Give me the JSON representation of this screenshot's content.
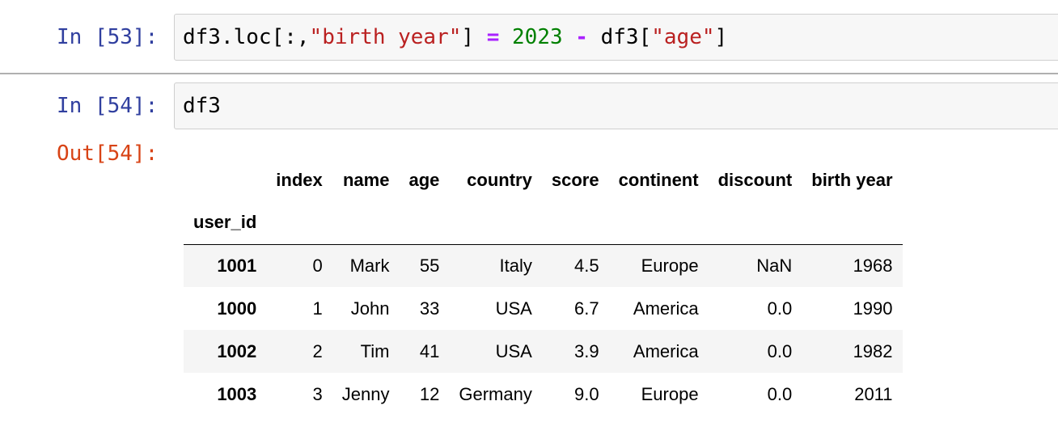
{
  "cells": [
    {
      "prompt": "In [53]:",
      "code": {
        "t1": "df3.loc[:,",
        "t2": "\"birth year\"",
        "t3": "] ",
        "t4": "=",
        "t5": " ",
        "t6": "2023",
        "t7": " ",
        "t8": "-",
        "t9": " df3[",
        "t10": "\"age\"",
        "t11": "]"
      }
    },
    {
      "prompt": "In [54]:",
      "code": "df3",
      "out_prompt": "Out[54]:"
    }
  ],
  "dataframe": {
    "columns": [
      "index",
      "name",
      "age",
      "country",
      "score",
      "continent",
      "discount",
      "birth year"
    ],
    "index_name": "user_id",
    "rows": [
      {
        "id": "1001",
        "values": [
          "0",
          "Mark",
          "55",
          "Italy",
          "4.5",
          "Europe",
          "NaN",
          "1968"
        ]
      },
      {
        "id": "1000",
        "values": [
          "1",
          "John",
          "33",
          "USA",
          "6.7",
          "America",
          "0.0",
          "1990"
        ]
      },
      {
        "id": "1002",
        "values": [
          "2",
          "Tim",
          "41",
          "USA",
          "3.9",
          "America",
          "0.0",
          "1982"
        ]
      },
      {
        "id": "1003",
        "values": [
          "3",
          "Jenny",
          "12",
          "Germany",
          "9.0",
          "Europe",
          "0.0",
          "2011"
        ]
      }
    ]
  },
  "colors": {
    "in_prompt": "#303f9f",
    "out_prompt": "#d84315",
    "string": "#ba2121",
    "operator": "#aa22ff",
    "number": "#008000"
  }
}
